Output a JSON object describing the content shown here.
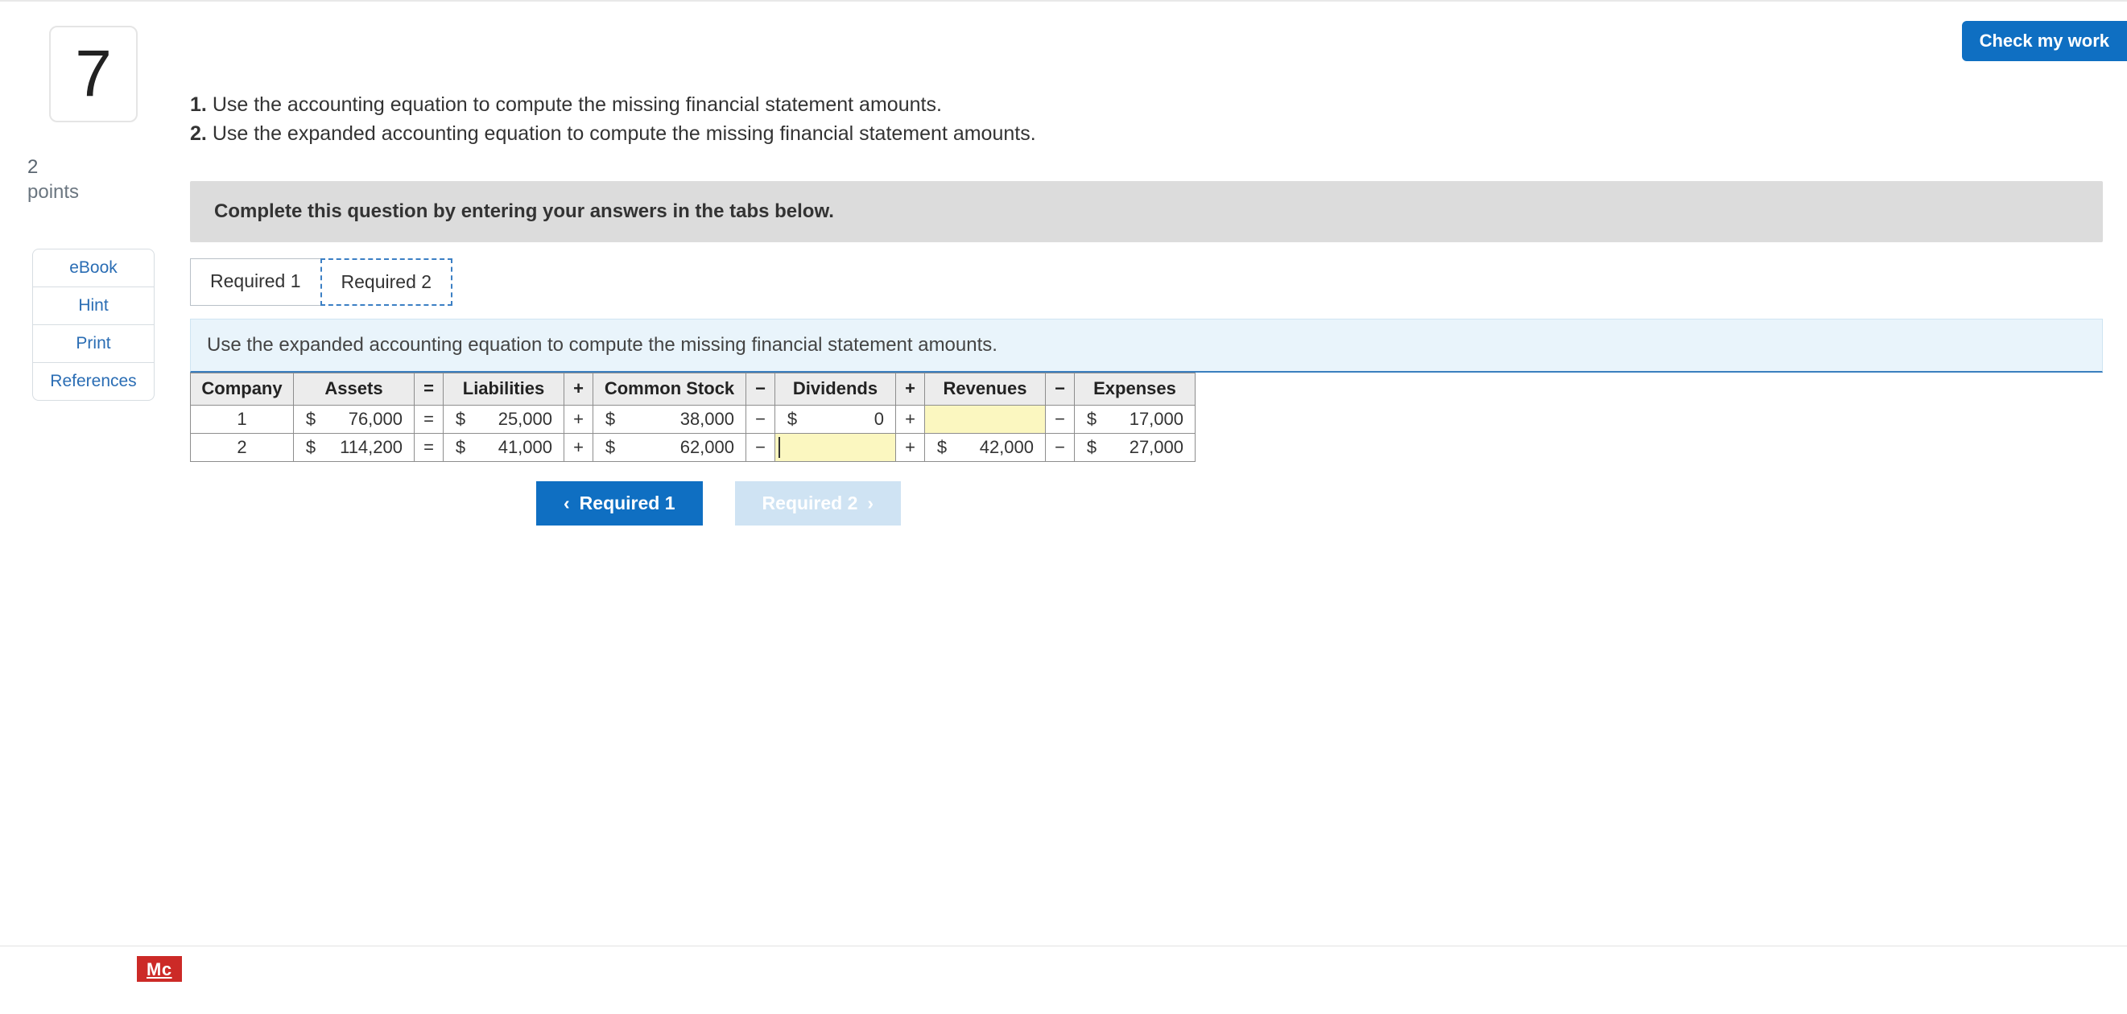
{
  "header": {
    "check_my_work": "Check my work"
  },
  "sidebar": {
    "question_number": "7",
    "points_value": "2",
    "points_label": "points",
    "links": [
      "eBook",
      "Hint",
      "Print",
      "References"
    ]
  },
  "instructions": {
    "items": [
      {
        "n": "1.",
        "text": "Use the accounting equation to compute the missing financial statement amounts."
      },
      {
        "n": "2.",
        "text": "Use the expanded accounting equation to compute the missing financial statement amounts."
      }
    ]
  },
  "tab_bar_instruction": "Complete this question by entering your answers in the tabs below.",
  "tabs": {
    "req1": "Required 1",
    "req2": "Required 2",
    "active": "req2"
  },
  "subprompt": "Use the expanded accounting equation to compute the missing financial statement amounts.",
  "table": {
    "headers": {
      "company": "Company",
      "assets": "Assets",
      "eq": "=",
      "liabilities": "Liabilities",
      "plus1": "+",
      "common_stock": "Common Stock",
      "minus1": "−",
      "dividends": "Dividends",
      "plus2": "+",
      "revenues": "Revenues",
      "minus2": "−",
      "expenses": "Expenses"
    },
    "rows": [
      {
        "company": "1",
        "assets": {
          "currency": "$",
          "value": "76,000",
          "input": false
        },
        "liabilities": {
          "currency": "$",
          "value": "25,000",
          "input": false
        },
        "common_stock": {
          "currency": "$",
          "value": "38,000",
          "input": false
        },
        "dividends": {
          "currency": "$",
          "value": "0",
          "input": false
        },
        "revenues": {
          "currency": "",
          "value": "",
          "input": true
        },
        "expenses": {
          "currency": "$",
          "value": "17,000",
          "input": false
        }
      },
      {
        "company": "2",
        "assets": {
          "currency": "$",
          "value": "114,200",
          "input": false
        },
        "liabilities": {
          "currency": "$",
          "value": "41,000",
          "input": false
        },
        "common_stock": {
          "currency": "$",
          "value": "62,000",
          "input": false
        },
        "dividends": {
          "currency": "",
          "value": "",
          "input": true,
          "focused": true
        },
        "revenues": {
          "currency": "$",
          "value": "42,000",
          "input": false
        },
        "expenses": {
          "currency": "$",
          "value": "27,000",
          "input": false
        }
      }
    ],
    "ops": {
      "eq": "=",
      "plus": "+",
      "minus": "−"
    }
  },
  "nav": {
    "prev": "Required 1",
    "next": "Required 2"
  },
  "footer_brand": "Mc"
}
